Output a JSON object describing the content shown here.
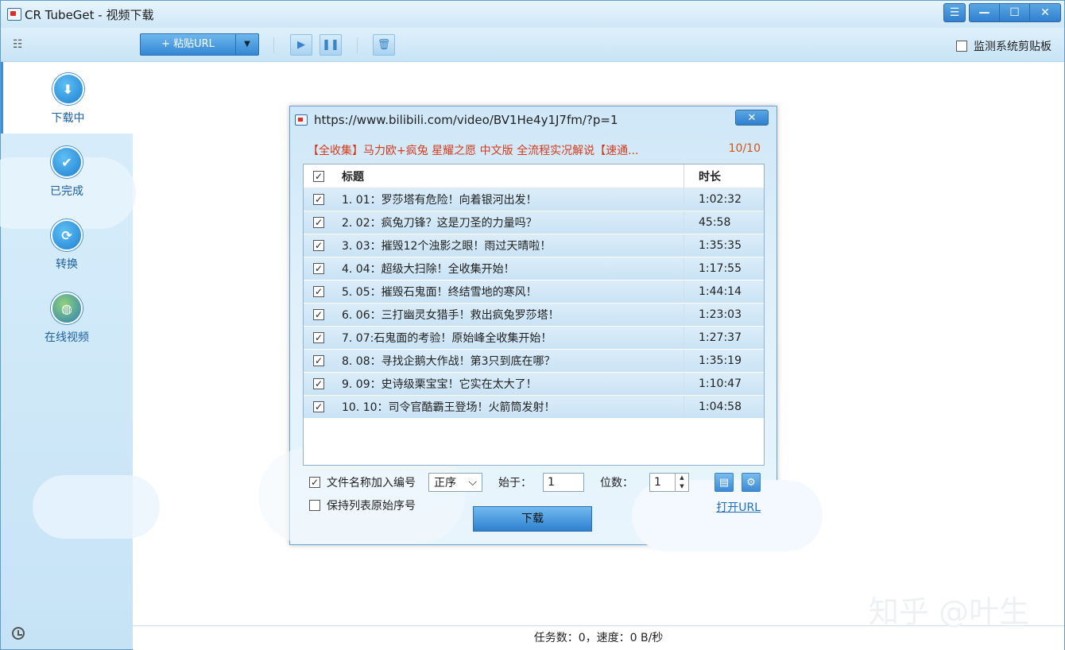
{
  "window": {
    "title": "CR TubeGet - 视频下载",
    "menu_glyph": "☰",
    "min": "—",
    "max": "☐",
    "close": "✕"
  },
  "toolbar": {
    "paste_label": "+ 粘贴URL",
    "paste_arrow": "▼",
    "play": "▶",
    "pause": "❚❚",
    "delete": "🗑",
    "monitor_label": "监测系统剪贴板",
    "monitor_checked": ""
  },
  "sidebar": {
    "items": [
      {
        "label": "下载中",
        "glyph": "⬇"
      },
      {
        "label": "已完成",
        "glyph": "✔"
      },
      {
        "label": "转换",
        "glyph": "⟳"
      },
      {
        "label": "在线视频",
        "glyph": "◍"
      }
    ]
  },
  "status": {
    "text": "任务数：0，速度：0 B/秒"
  },
  "watermark": "知乎 @叶生",
  "dialog": {
    "url": "https://www.bilibili.com/video/BV1He4y1J7fm/?p=1",
    "close": "✕",
    "video_title": "【全收集】马力欧+疯兔 星耀之愿 中文版 全流程实况解说【速通...",
    "count": "10/10",
    "columns": {
      "title": "标题",
      "duration": "时长"
    },
    "check": "✓",
    "rows": [
      {
        "title": "1. 01：罗莎塔有危险！向着银河出发！",
        "duration": "1:02:32"
      },
      {
        "title": "2. 02：疯兔刀锋？这是刀圣的力量吗？",
        "duration": "45:58"
      },
      {
        "title": "3. 03：摧毁12个浊影之眼！雨过天晴啦！",
        "duration": "1:35:35"
      },
      {
        "title": "4. 04：超级大扫除！全收集开始！",
        "duration": "1:17:55"
      },
      {
        "title": "5. 05：摧毁石鬼面！终结雪地的寒风！",
        "duration": "1:44:14"
      },
      {
        "title": "6. 06：三打幽灵女猎手！救出疯兔罗莎塔！",
        "duration": "1:23:03"
      },
      {
        "title": "7. 07:石鬼面的考验！原始峰全收集开始！",
        "duration": "1:27:37"
      },
      {
        "title": "8. 08：寻找企鹅大作战！第3只到底在哪？",
        "duration": "1:35:19"
      },
      {
        "title": "9. 09：史诗级栗宝宝！它实在太大了！",
        "duration": "1:10:47"
      },
      {
        "title": "10. 10：司令官酷霸王登场！火箭筒发射！",
        "duration": "1:04:58"
      }
    ],
    "options": {
      "add_number_label": "文件名称加入编号",
      "order_value": "正序",
      "order_arrow": "⌵",
      "start_label": "始于：",
      "start_value": "1",
      "digits_label": "位数：",
      "digits_value": "1",
      "spin_up": "▲",
      "spin_down": "▼",
      "keep_order_label": "保持列表原始序号",
      "open_url": "打开URL",
      "download": "下载",
      "copy_glyph": "▤",
      "settings_glyph": "⚙"
    }
  }
}
